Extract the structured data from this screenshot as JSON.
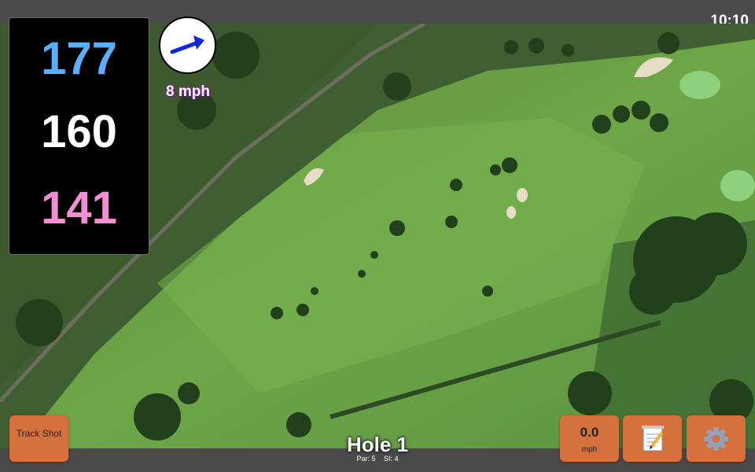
{
  "status": {
    "time": "10:10"
  },
  "distances": {
    "back": "177",
    "middle": "160",
    "front": "141"
  },
  "wind": {
    "speed": "8 mph"
  },
  "hole": {
    "title": "Hole 1",
    "par": "Par: 5",
    "si": "SI: 4"
  },
  "buttons": {
    "track_shot": "Track Shot",
    "speed_value": "0.0",
    "speed_unit": "mph"
  },
  "icons": {
    "wind": "wind-arrow-icon",
    "notes": "notepad-pencil-icon",
    "settings": "gear-icon"
  },
  "colors": {
    "back_distance": "#5aaeff",
    "middle_distance": "#ffffff",
    "front_distance": "#f48ed4",
    "button": "#d6713e",
    "wind_arrow": "#1028e0"
  }
}
